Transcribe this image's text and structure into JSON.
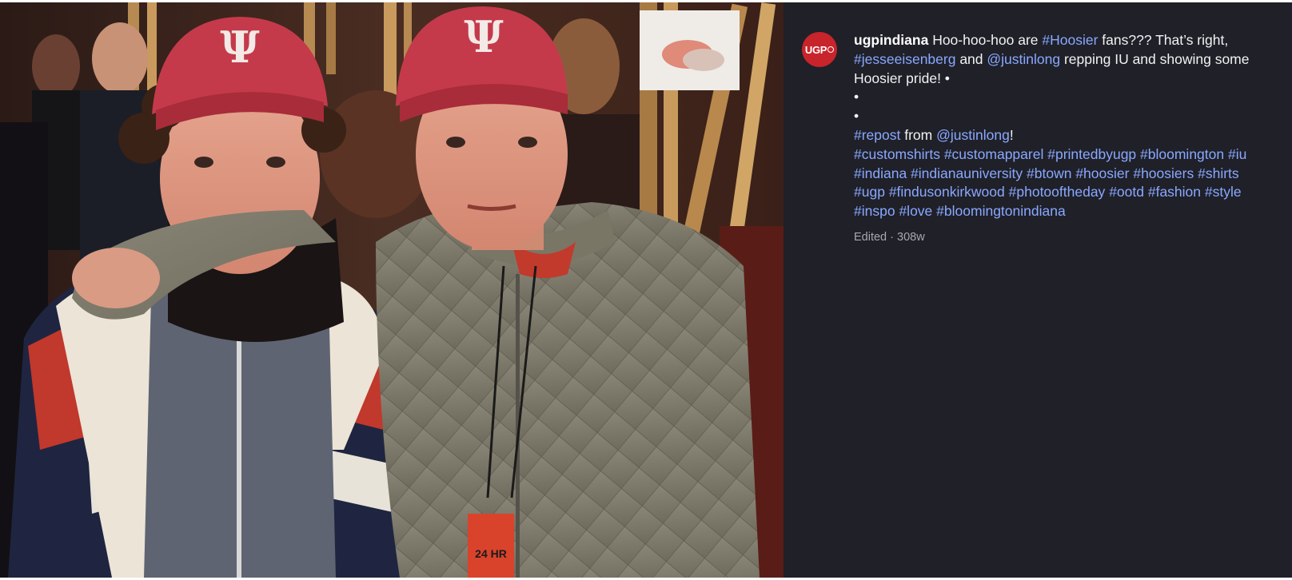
{
  "post": {
    "username": "ugpindiana",
    "avatar_label": "UGP",
    "caption": {
      "intro": " Hoo-hoo-hoo are ",
      "hashtag_hoosier": "#Hoosier",
      "fans_text": " fans??? That’s right,",
      "hashtag_jesse": "#jesseeisenberg",
      "and_text": " and ",
      "mention_justin": "@justinlong",
      "repping_text": " repping IU and showing some",
      "pride_text": "Hoosier pride! •",
      "bullet_1": "•",
      "bullet_2": "•",
      "repost_tag": "#repost",
      "from_text": " from ",
      "mention_justin_2": "@justinlong",
      "exclaim": "!",
      "hashtags": [
        "#customshirts",
        "#customapparel",
        "#printedbyugp",
        "#bloomington",
        "#iu",
        "#indiana",
        "#indianauniversity",
        "#btown",
        "#hoosier",
        "#hoosiers",
        "#shirts",
        "#ugp",
        "#findusonkirkwood",
        "#photooftheday",
        "#ootd",
        "#fashion",
        "#style",
        "#inspo",
        "#love",
        "#bloomingtonindiana"
      ]
    },
    "edited_label": "Edited",
    "separator": " · ",
    "age": "308w"
  },
  "photo": {
    "cap_logo": "Ψ",
    "badge_text": "24 HR"
  },
  "colors": {
    "panel_bg": "#1f2028",
    "link": "#8aa8ff",
    "cap_red": "#c43a4a",
    "avatar_red": "#c8242b"
  }
}
